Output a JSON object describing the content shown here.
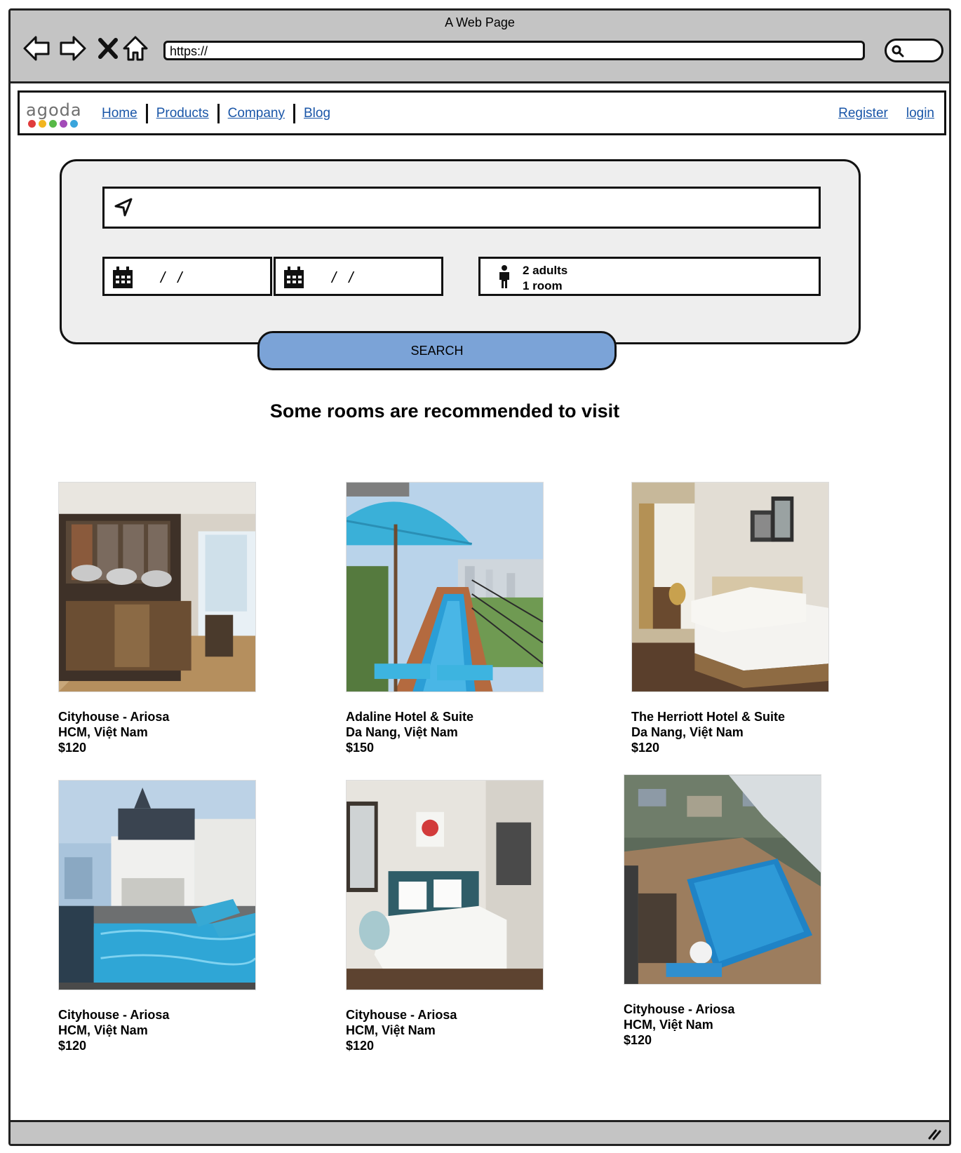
{
  "browser": {
    "title": "A Web Page",
    "url": "https://",
    "icons": [
      "back-arrow-icon",
      "forward-arrow-icon",
      "close-x-icon",
      "home-icon",
      "search-icon"
    ]
  },
  "nav": {
    "logo_text": "agoda",
    "logo_colors": [
      "#e03c3c",
      "#f2b51f",
      "#58b947",
      "#a34bb8",
      "#3aa5dc"
    ],
    "links": [
      "Home",
      "Products",
      "Company",
      "Blog"
    ],
    "register": "Register",
    "login": "login"
  },
  "search": {
    "location_value": "",
    "checkin": "/ /",
    "checkout": "/ /",
    "guests_adults": "2 adults",
    "guests_rooms": "1 room",
    "button": "SEARCH",
    "button_color": "#7ba3d7"
  },
  "section_title": "Some rooms are recommended to visit",
  "hotels": [
    {
      "name": "Cityhouse - Ariosa",
      "location": "HCM, Việt Nam",
      "price": "$120"
    },
    {
      "name": "Adaline Hotel & Suite",
      "location": "Da Nang, Việt Nam",
      "price": "$150"
    },
    {
      "name": "The Herriott Hotel & Suite",
      "location": "Da Nang, Việt Nam",
      "price": "$120"
    },
    {
      "name": "Cityhouse - Ariosa",
      "location": "HCM, Việt Nam",
      "price": "$120"
    },
    {
      "name": "Cityhouse - Ariosa",
      "location": "HCM, Việt Nam",
      "price": "$120"
    },
    {
      "name": "Cityhouse - Ariosa",
      "location": "HCM, Việt Nam",
      "price": "$120"
    }
  ]
}
